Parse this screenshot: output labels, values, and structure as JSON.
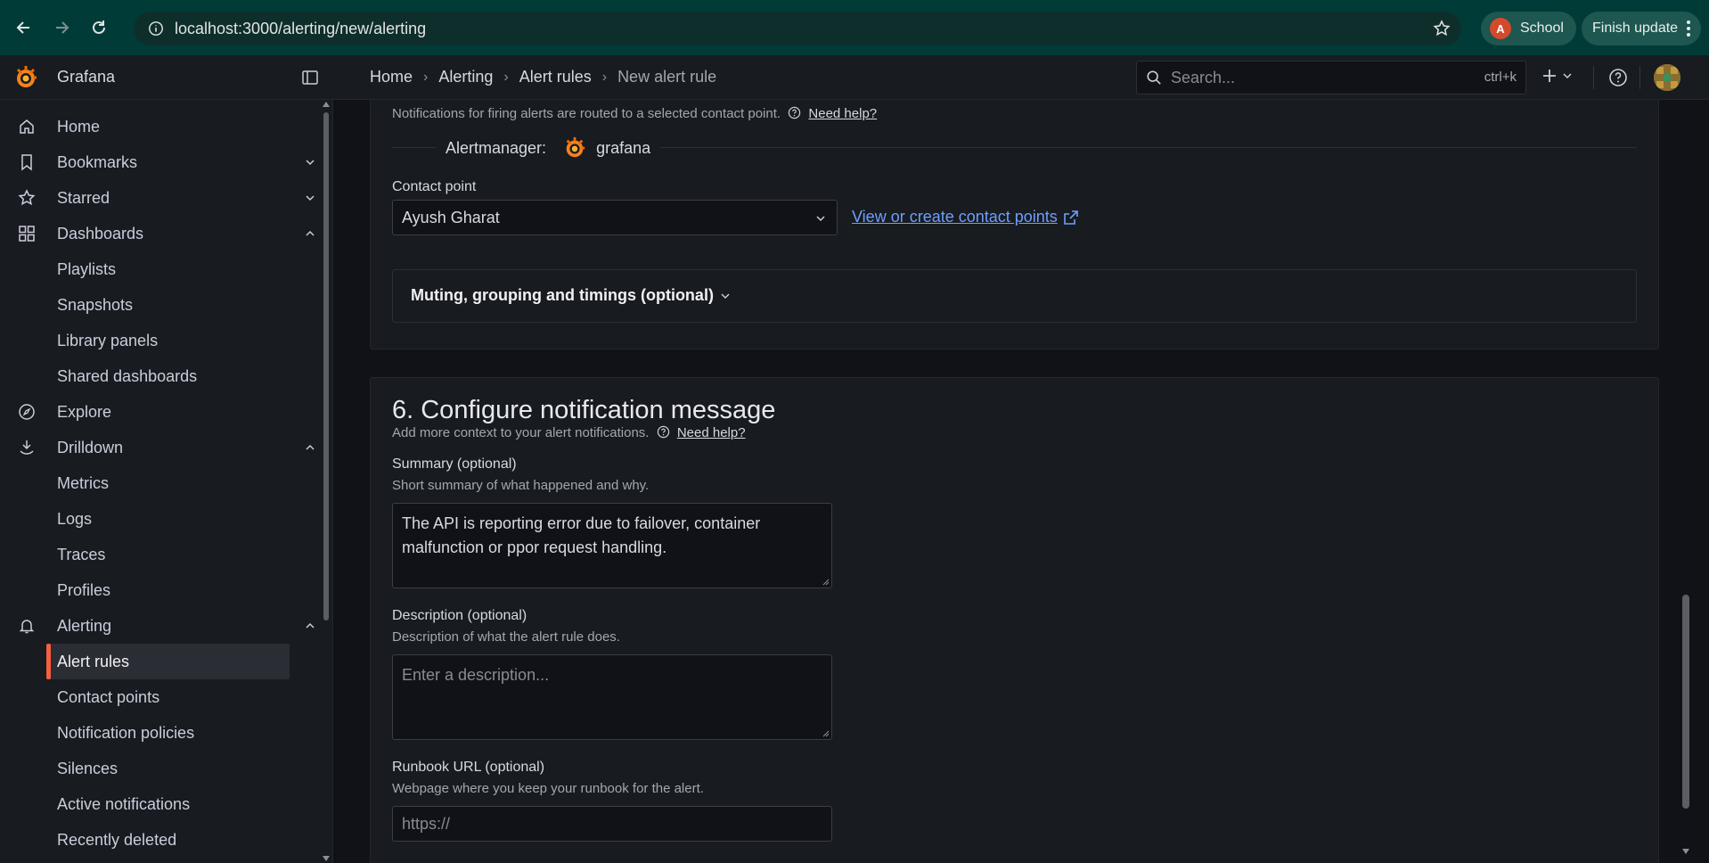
{
  "browser": {
    "url": "localhost:3000/alerting/new/alerting",
    "profile_initial": "A",
    "profile_name": "School",
    "update_label": "Finish update"
  },
  "topbar": {
    "brand": "Grafana",
    "breadcrumb": [
      "Home",
      "Alerting",
      "Alert rules",
      "New alert rule"
    ],
    "search_placeholder": "Search...",
    "search_shortcut": "ctrl+k"
  },
  "sidebar": {
    "items": [
      {
        "label": "Home",
        "icon": "home-icon"
      },
      {
        "label": "Bookmarks",
        "icon": "bookmark-icon"
      },
      {
        "label": "Starred",
        "icon": "star-icon"
      },
      {
        "label": "Dashboards",
        "icon": "apps-icon"
      },
      {
        "label": "Playlists"
      },
      {
        "label": "Snapshots"
      },
      {
        "label": "Library panels"
      },
      {
        "label": "Shared dashboards"
      },
      {
        "label": "Explore",
        "icon": "compass-icon"
      },
      {
        "label": "Drilldown",
        "icon": "drilldown-icon"
      },
      {
        "label": "Metrics"
      },
      {
        "label": "Logs"
      },
      {
        "label": "Traces"
      },
      {
        "label": "Profiles"
      },
      {
        "label": "Alerting",
        "icon": "bell-icon"
      },
      {
        "label": "Alert rules",
        "active": true
      },
      {
        "label": "Contact points"
      },
      {
        "label": "Notification policies"
      },
      {
        "label": "Silences"
      },
      {
        "label": "Active notifications"
      },
      {
        "label": "Recently deleted"
      }
    ]
  },
  "notifications_section": {
    "help_text": "Notifications for firing alerts are routed to a selected contact point.",
    "need_help": "Need help?",
    "alertmanager_label": "Alertmanager:",
    "alertmanager_name": "grafana",
    "contact_point_label": "Contact point",
    "contact_point_value": "Ayush Gharat",
    "view_contact_points": "View or create contact points",
    "muting_label": "Muting, grouping and timings (optional)"
  },
  "message_section": {
    "title": "6. Configure notification message",
    "subtitle": "Add more context to your alert notifications.",
    "need_help": "Need help?",
    "summary_label": "Summary (optional)",
    "summary_desc": "Short summary of what happened and why.",
    "summary_value": "The API is reporting error due to failover, container malfunction or ppor request handling.",
    "description_label": "Description (optional)",
    "description_desc": "Description of what the alert rule does.",
    "description_placeholder": "Enter a description...",
    "runbook_label": "Runbook URL (optional)",
    "runbook_desc": "Webpage where you keep your runbook for the alert.",
    "runbook_placeholder": "https://"
  },
  "colors": {
    "accent_orange": "#f55f3e",
    "link_blue": "#6e9fff",
    "chrome_bg": "#003b38"
  }
}
